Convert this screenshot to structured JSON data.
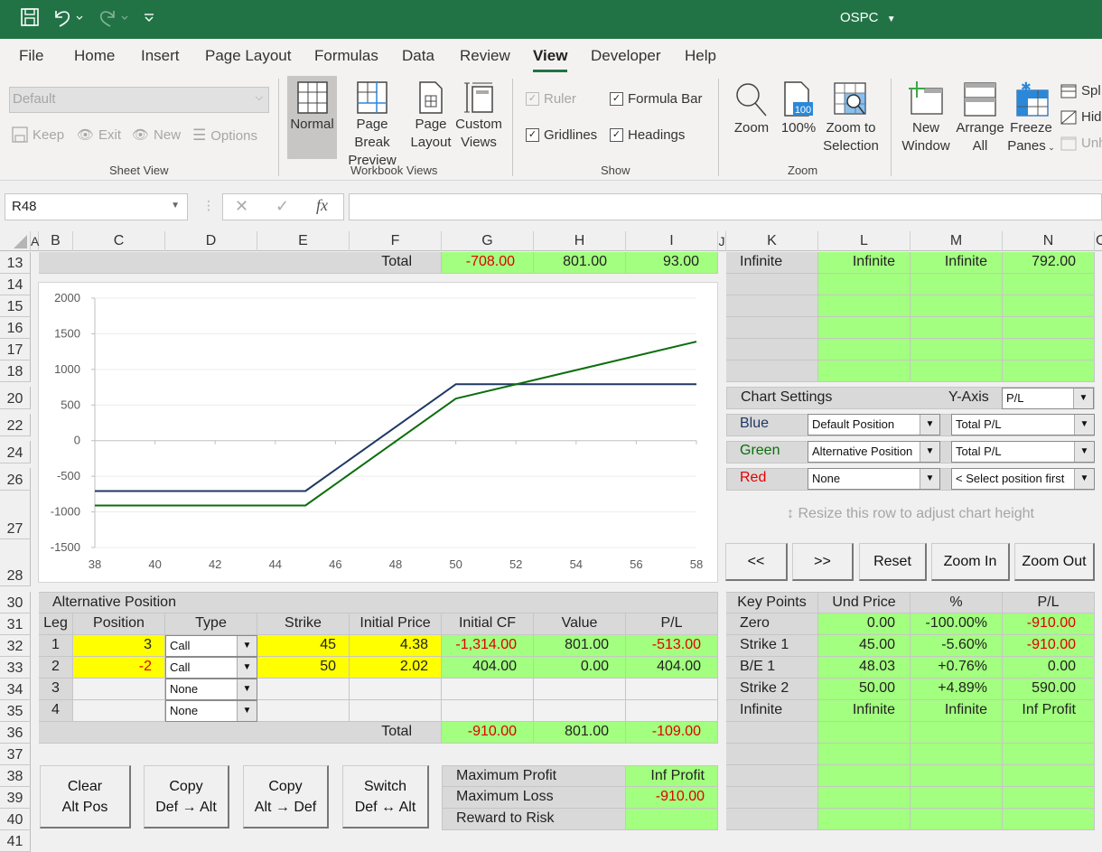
{
  "titlebar": {
    "title": "OSPC",
    "title_dropdown_icon": "caret-down-icon",
    "quick_access": [
      "save-icon",
      "undo-icon",
      "redo-icon",
      "customize-qat-icon"
    ]
  },
  "tabs": [
    {
      "label": "File",
      "active": false
    },
    {
      "label": "Home",
      "active": false
    },
    {
      "label": "Insert",
      "active": false
    },
    {
      "label": "Page Layout",
      "active": false
    },
    {
      "label": "Formulas",
      "active": false
    },
    {
      "label": "Data",
      "active": false
    },
    {
      "label": "Review",
      "active": false
    },
    {
      "label": "View",
      "active": true
    },
    {
      "label": "Developer",
      "active": false
    },
    {
      "label": "Help",
      "active": false
    }
  ],
  "ribbon": {
    "sheet_view": {
      "group_label": "Sheet View",
      "select_value": "Default",
      "keep": "Keep",
      "exit": "Exit",
      "new": "New",
      "options": "Options"
    },
    "workbook_views": {
      "group_label": "Workbook Views",
      "normal": "Normal",
      "page_break_1": "Page Break",
      "page_break_2": "Preview",
      "page_layout_1": "Page",
      "page_layout_2": "Layout",
      "custom_1": "Custom",
      "custom_2": "Views"
    },
    "show": {
      "group_label": "Show",
      "ruler": {
        "label": "Ruler",
        "checked": true,
        "disabled": true
      },
      "formula_bar": {
        "label": "Formula Bar",
        "checked": true
      },
      "gridlines": {
        "label": "Gridlines",
        "checked": true
      },
      "headings": {
        "label": "Headings",
        "checked": true
      }
    },
    "zoom": {
      "group_label": "Zoom",
      "zoom": "Zoom",
      "hundred": "100%",
      "hundred_icon_text": "100",
      "zoom_sel_1": "Zoom to",
      "zoom_sel_2": "Selection"
    },
    "window": {
      "new_window_1": "New",
      "new_window_2": "Window",
      "arrange_1": "Arrange",
      "arrange_2": "All",
      "freeze_1": "Freeze",
      "freeze_2": "Panes",
      "split": "Spl",
      "hide": "Hid",
      "unhide": "Unh"
    }
  },
  "formula_bar": {
    "name_box": "R48",
    "formula": ""
  },
  "columns": [
    "A",
    "B",
    "C",
    "D",
    "E",
    "F",
    "G",
    "H",
    "I",
    "J",
    "K",
    "L",
    "M",
    "N",
    "O"
  ],
  "rows": [
    "13",
    "14",
    "15",
    "16",
    "17",
    "18",
    "20",
    "22",
    "24",
    "26",
    "27",
    "28",
    "30",
    "31",
    "32",
    "33",
    "34",
    "35",
    "36",
    "37",
    "38",
    "39",
    "40",
    "41"
  ],
  "default_total": {
    "label": "Total",
    "initial_cf": "-708.00",
    "value": "801.00",
    "pl": "93.00"
  },
  "default_keypoints_last": {
    "label": "Infinite",
    "und_price": "Infinite",
    "pct": "Infinite",
    "pl": "792.00"
  },
  "chart_settings": {
    "title": "Chart Settings",
    "yaxis_label": "Y-Axis",
    "yaxis_value": "P/L",
    "rows": [
      {
        "color_name": "Blue",
        "color": "#1f3864",
        "position": "Default Position",
        "metric": "Total P/L"
      },
      {
        "color_name": "Green",
        "color": "#0b6e0b",
        "position": "Alternative Position",
        "metric": "Total P/L"
      },
      {
        "color_name": "Red",
        "color": "#e00000",
        "position": "None",
        "metric": "< Select position first"
      }
    ],
    "resize_hint": "Resize this row to adjust chart height",
    "buttons": [
      "<<",
      ">>",
      "Reset",
      "Zoom In",
      "Zoom Out"
    ]
  },
  "alt_position": {
    "title": "Alternative Position",
    "headers": [
      "Leg",
      "Position",
      "Type",
      "Strike",
      "Initial Price",
      "Initial CF",
      "Value",
      "P/L"
    ],
    "legs": [
      {
        "leg": "1",
        "position": "3",
        "type": "Call",
        "strike": "45",
        "initial_price": "4.38",
        "initial_cf": "-1,314.00",
        "value": "801.00",
        "pl": "-513.00"
      },
      {
        "leg": "2",
        "position": "-2",
        "type": "Call",
        "strike": "50",
        "initial_price": "2.02",
        "initial_cf": "404.00",
        "value": "0.00",
        "pl": "404.00"
      },
      {
        "leg": "3",
        "position": "",
        "type": "None",
        "strike": "",
        "initial_price": "",
        "initial_cf": "",
        "value": "",
        "pl": ""
      },
      {
        "leg": "4",
        "position": "",
        "type": "None",
        "strike": "",
        "initial_price": "",
        "initial_cf": "",
        "value": "",
        "pl": ""
      }
    ],
    "total": {
      "label": "Total",
      "initial_cf": "-910.00",
      "value": "801.00",
      "pl": "-109.00"
    }
  },
  "key_points": {
    "headers": [
      "Key Points",
      "Und Price",
      "%",
      "P/L"
    ],
    "rows": [
      {
        "label": "Zero",
        "und_price": "0.00",
        "pct": "-100.00%",
        "pl": "-910.00"
      },
      {
        "label": "Strike 1",
        "und_price": "45.00",
        "pct": "-5.60%",
        "pl": "-910.00"
      },
      {
        "label": "B/E 1",
        "und_price": "48.03",
        "pct": "+0.76%",
        "pl": "0.00"
      },
      {
        "label": "Strike 2",
        "und_price": "50.00",
        "pct": "+4.89%",
        "pl": "590.00"
      },
      {
        "label": "Infinite",
        "und_price": "Infinite",
        "pct": "Infinite",
        "pl": "Inf Profit"
      }
    ]
  },
  "action_buttons": [
    {
      "line1": "Clear",
      "line2": "Alt Pos"
    },
    {
      "line1": "Copy",
      "line2": "Def → Alt"
    },
    {
      "line1": "Copy",
      "line2": "Alt → Def"
    },
    {
      "line1": "Switch",
      "line2": "Def ↔ Alt"
    }
  ],
  "summary": {
    "max_profit_label": "Maximum Profit",
    "max_profit": "Inf Profit",
    "max_loss_label": "Maximum Loss",
    "max_loss": "-910.00",
    "reward_risk_label": "Reward to Risk",
    "reward_risk": ""
  },
  "colors": {
    "excel_green": "#217346",
    "cell_green": "#a3ff7f",
    "input_yellow": "#ffff00",
    "negative_red": "#e00000"
  },
  "chart_data": {
    "type": "line",
    "title": "",
    "xlabel": "",
    "ylabel": "",
    "xlim": [
      38,
      58
    ],
    "ylim": [
      -1500,
      2000
    ],
    "x_ticks": [
      38,
      40,
      42,
      44,
      46,
      48,
      50,
      52,
      54,
      56,
      58
    ],
    "y_ticks": [
      -1500,
      -1000,
      -500,
      0,
      500,
      1000,
      1500,
      2000
    ],
    "grid": true,
    "legend": "none",
    "x": [
      38,
      45,
      50,
      58
    ],
    "series": [
      {
        "name": "Default Position (Blue)",
        "color": "#1f3864",
        "values": [
          -708,
          -708,
          792,
          792
        ]
      },
      {
        "name": "Alternative Position (Green)",
        "color": "#0b6e0b",
        "values": [
          -910,
          -910,
          590,
          1390
        ]
      }
    ]
  }
}
